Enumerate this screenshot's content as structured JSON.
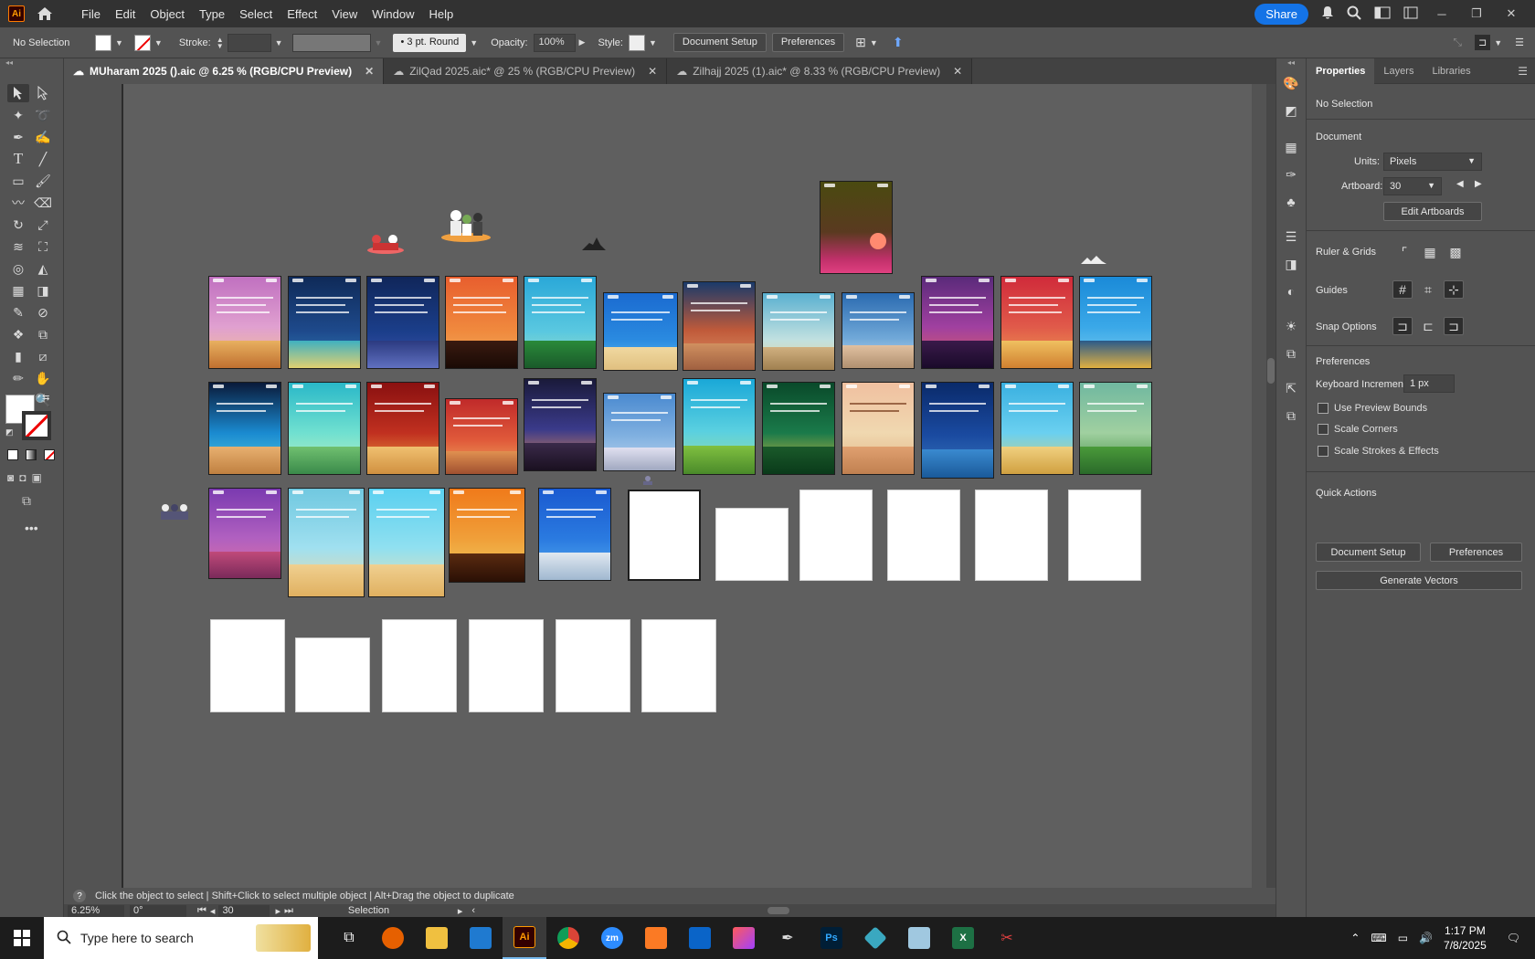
{
  "app": {
    "logo_text": "Ai"
  },
  "menu": [
    "File",
    "Edit",
    "Object",
    "Type",
    "Select",
    "Effect",
    "View",
    "Window",
    "Help"
  ],
  "menubar_right": {
    "share_label": "Share"
  },
  "controlbar": {
    "selection": "No Selection",
    "stroke_label": "Stroke:",
    "brush_label": "3 pt. Round",
    "opacity_label": "Opacity:",
    "opacity_value": "100%",
    "style_label": "Style:",
    "doc_setup_btn": "Document Setup",
    "prefs_btn": "Preferences"
  },
  "tabs": [
    {
      "label": "MUharam 2025 ().aic @ 6.25 % (RGB/CPU Preview)",
      "active": true
    },
    {
      "label": "ZilQad 2025.aic* @ 25 % (RGB/CPU Preview)",
      "active": false
    },
    {
      "label": "Zilhajj 2025 (1).aic* @ 8.33 % (RGB/CPU Preview)",
      "active": false
    }
  ],
  "panel": {
    "tabs": [
      "Properties",
      "Layers",
      "Libraries"
    ],
    "no_selection": "No Selection",
    "document_title": "Document",
    "units_label": "Units:",
    "units_value": "Pixels",
    "artboard_label": "Artboard:",
    "artboard_value": "30",
    "edit_artboards_btn": "Edit Artboards",
    "rulers_grids": "Ruler & Grids",
    "guides": "Guides",
    "snap_options": "Snap Options",
    "preferences_title": "Preferences",
    "keyboard_increment_label": "Keyboard Increment:",
    "keyboard_increment_value": "1 px",
    "checkboxes": [
      "Use Preview Bounds",
      "Scale Corners",
      "Scale Strokes & Effects"
    ],
    "quick_actions": "Quick Actions",
    "qa_document_setup": "Document Setup",
    "qa_preferences": "Preferences",
    "qa_generate_vectors": "Generate Vectors"
  },
  "hint_text": "Click the object to select  |  Shift+Click to select multiple object  |  Alt+Drag the object to duplicate",
  "status": {
    "zoom": "6.25%",
    "rotation": "0°",
    "artboard_nav": "30",
    "tool": "Selection"
  },
  "taskbar": {
    "search_placeholder": "Type here to search",
    "time": "1:17 PM",
    "date": "7/8/2025"
  },
  "colors": {
    "accent": "#1473e6",
    "ui_dark": "#323232",
    "ui_mid": "#535353",
    "canvas": "#5f5f5f"
  }
}
